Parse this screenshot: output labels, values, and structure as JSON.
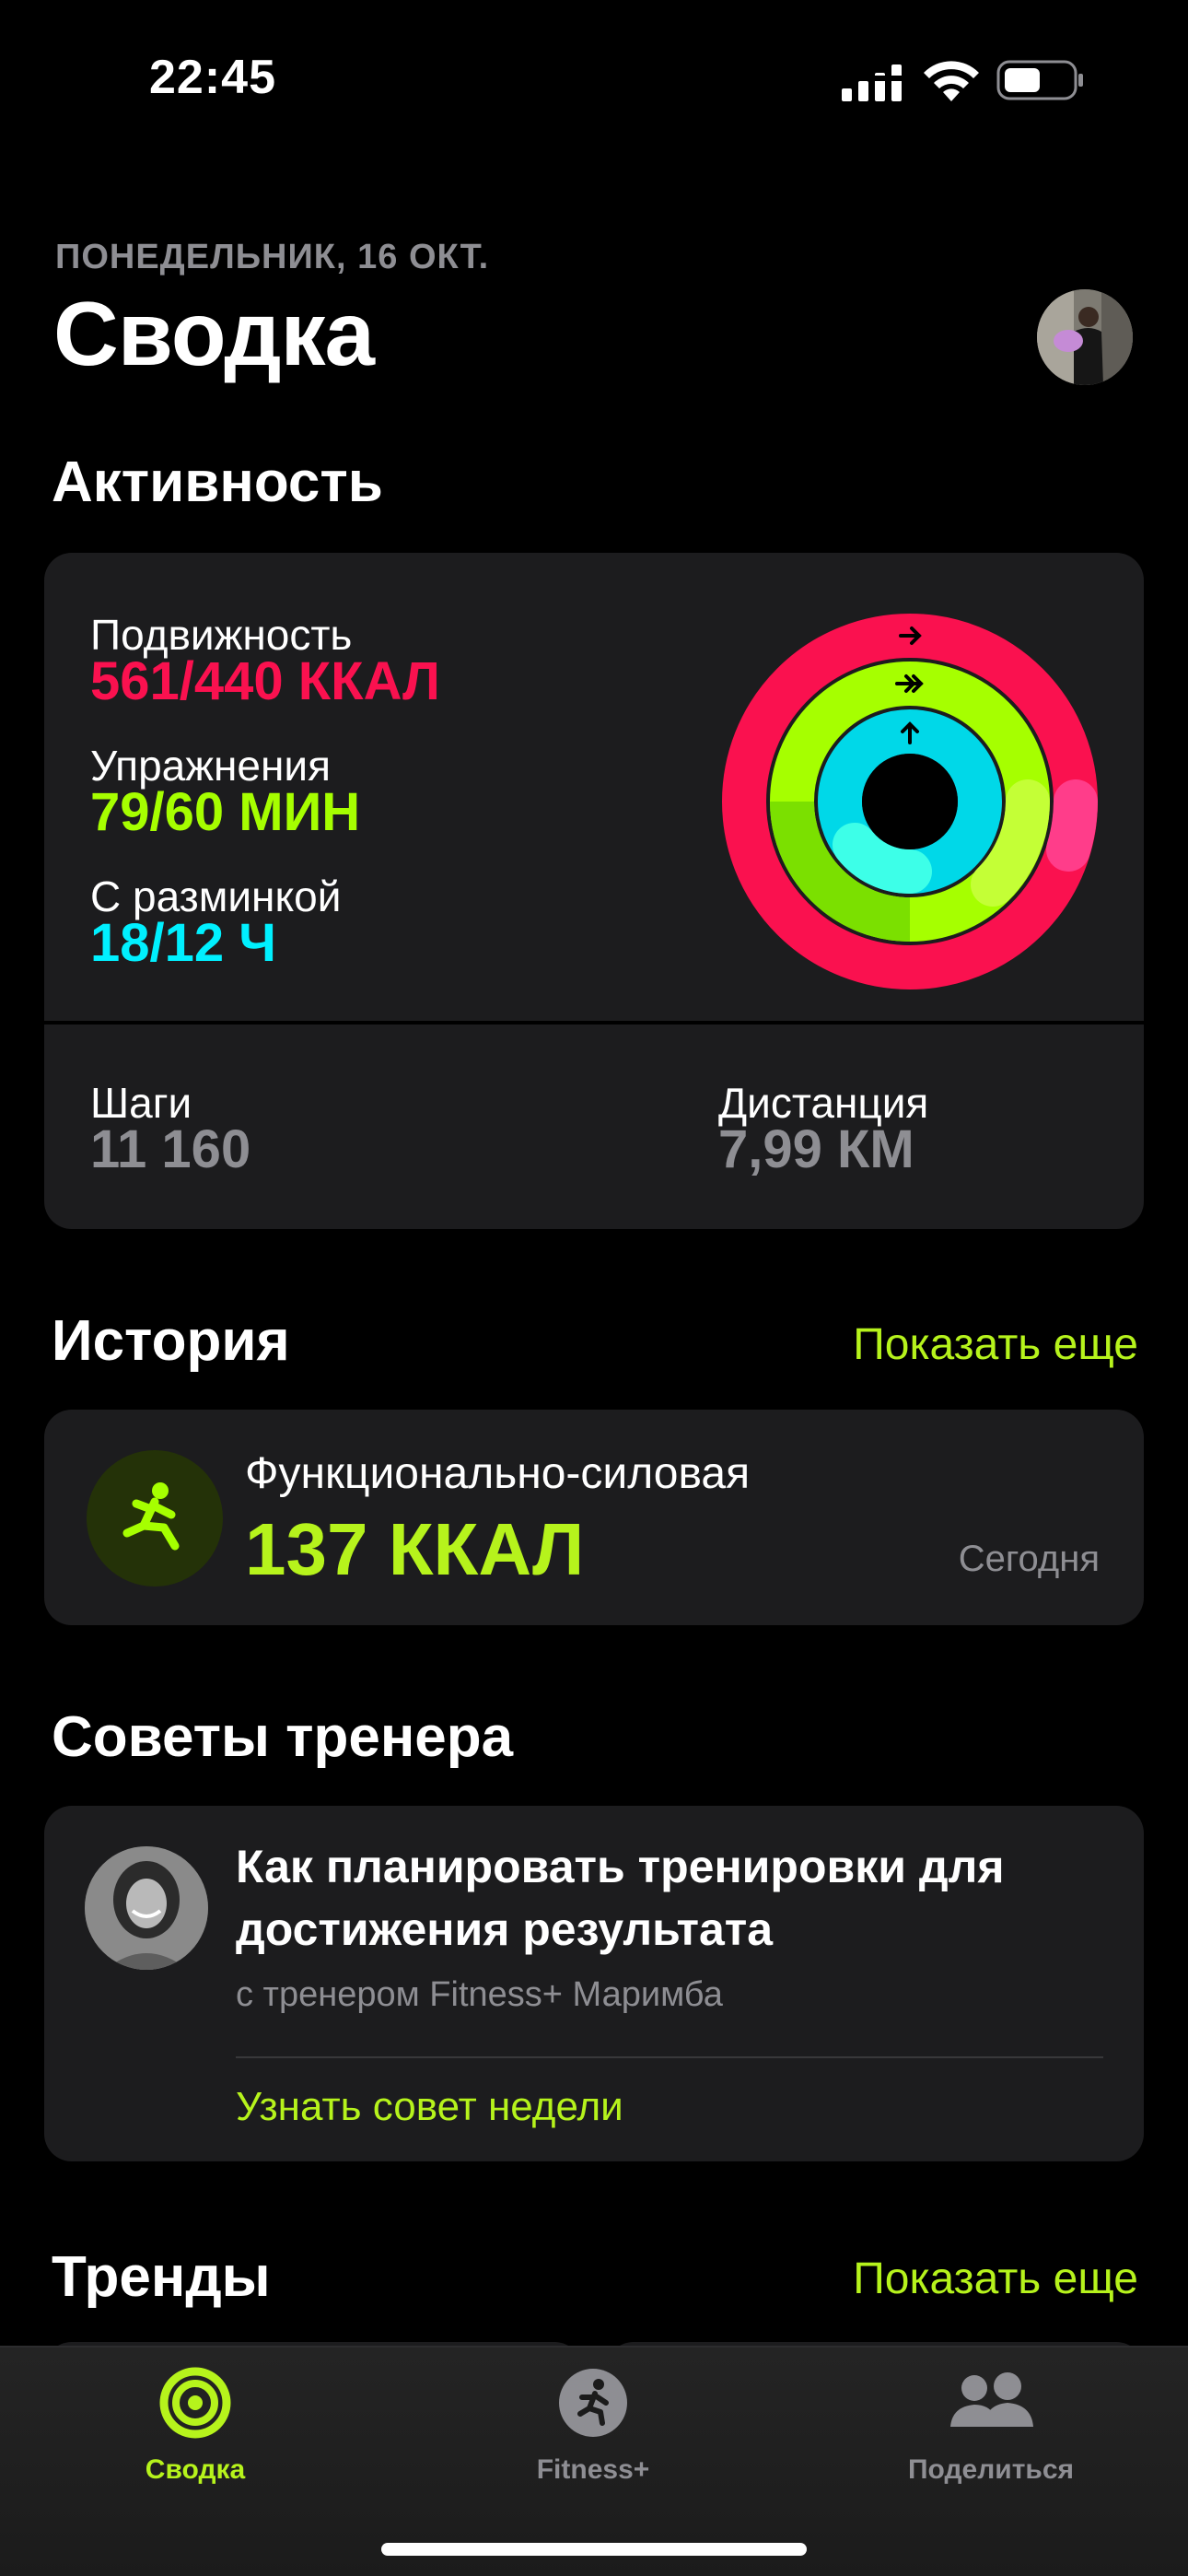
{
  "status_bar": {
    "time": "22:45"
  },
  "header": {
    "date": "ПОНЕДЕЛЬНИК, 16 ОКТ.",
    "title": "Сводка"
  },
  "activity": {
    "heading": "Активность",
    "move": {
      "label": "Подвижность",
      "value": "561/440 ККАЛ",
      "color": "#fa114f"
    },
    "exercise": {
      "label": "Упражнения",
      "value": "79/60 МИН",
      "color": "#a6ff00"
    },
    "stand": {
      "label": "С разминкой",
      "value": "18/12 Ч",
      "color": "#00f0ff"
    },
    "steps": {
      "label": "Шаги",
      "value": "11 160"
    },
    "distance": {
      "label": "Дистанция",
      "value": "7,99 КМ"
    }
  },
  "history": {
    "heading": "История",
    "show_more": "Показать еще",
    "workout": {
      "name": "Функционально-силовая",
      "kcal": "137 ККАЛ",
      "date": "Сегодня"
    }
  },
  "trainer": {
    "heading": "Советы тренера",
    "title": "Как планировать тренировки для достижения результата",
    "subtitle": "с тренером Fitness+ Маримба",
    "link": "Узнать совет недели"
  },
  "trends": {
    "heading": "Тренды",
    "show_more": "Показать еще"
  },
  "tab_bar": {
    "tabs": [
      {
        "label": "Сводка",
        "icon": "activity-rings-icon",
        "active": true
      },
      {
        "label": "Fitness+",
        "icon": "runner-icon",
        "active": false
      },
      {
        "label": "Поделиться",
        "icon": "people-icon",
        "active": false
      }
    ]
  },
  "colors": {
    "accent": "#b6f31c",
    "card": "#1c1c1e",
    "secondary_text": "#8e8e93"
  }
}
